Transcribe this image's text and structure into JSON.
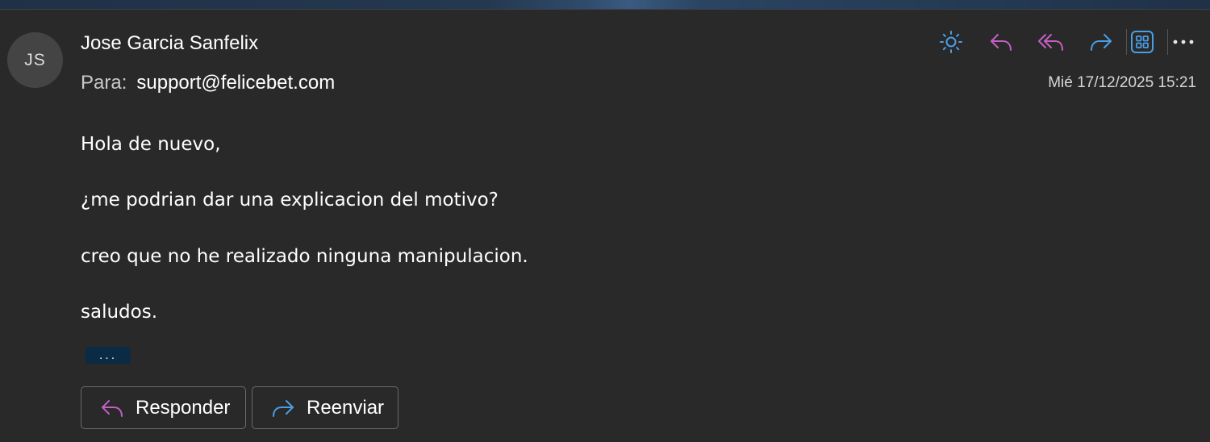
{
  "sender": {
    "initials": "JS",
    "name": "Jose Garcia Sanfelix"
  },
  "recipient": {
    "label": "Para:",
    "address": "support@felicebet.com"
  },
  "timestamp": "Mié 17/12/2025 15:21",
  "toolbar": {
    "icons": [
      "sun-icon",
      "reply-icon",
      "reply-all-icon",
      "forward-icon",
      "apps-icon",
      "more-options-icon"
    ]
  },
  "message": {
    "lines": [
      "Hola de nuevo,",
      "¿me podrian dar una explicacion del motivo?",
      "creo que no he realizado ninguna manipulacion.",
      "saludos."
    ],
    "expand_label": "..."
  },
  "actions": {
    "reply_label": "Responder",
    "forward_label": "Reenviar"
  },
  "colors": {
    "background": "#292929",
    "reply_accent": "#c45fc4",
    "forward_accent": "#4a9ee6",
    "sun_accent": "#4a9ee6"
  }
}
